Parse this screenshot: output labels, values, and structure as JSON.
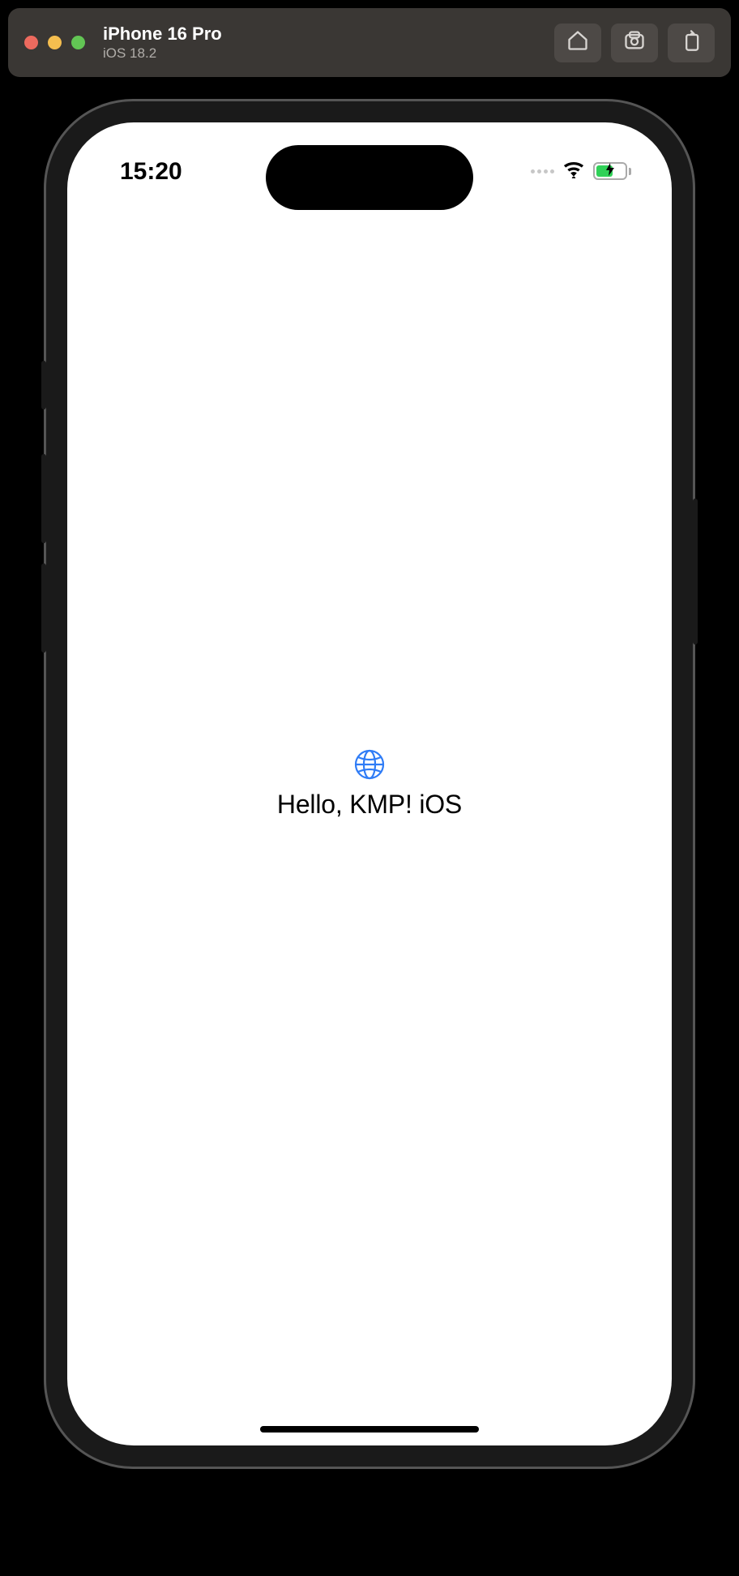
{
  "simulator": {
    "title": "iPhone 16 Pro",
    "subtitle": "iOS 18.2",
    "actions": {
      "home": "home-icon",
      "screenshot": "camera-icon",
      "rotate": "rotate-icon"
    }
  },
  "status": {
    "time": "15:20"
  },
  "app": {
    "text": "Hello, KMP! iOS"
  },
  "colors": {
    "accent": "#2f7cf6",
    "battery_fill": "#30d158"
  }
}
